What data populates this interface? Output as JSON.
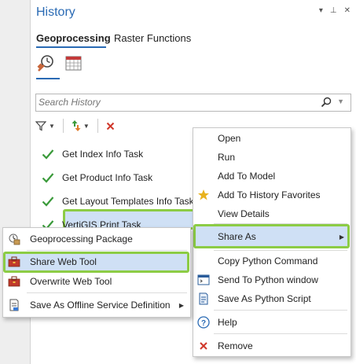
{
  "pane": {
    "title": "History",
    "controls": [
      "▾",
      "⊥",
      "✕"
    ]
  },
  "tabs": [
    {
      "label": "Geoprocessing",
      "selected": true
    },
    {
      "label": "Raster Functions",
      "selected": false
    }
  ],
  "search": {
    "placeholder": "Search History"
  },
  "history_items": [
    {
      "label": "Get Index Info Task"
    },
    {
      "label": "Get Product Info Task"
    },
    {
      "label": "Get Layout Templates Info Task"
    },
    {
      "label": "VertiGIS Print Task",
      "selected": true
    }
  ],
  "context_menu": {
    "items": [
      {
        "label": "Open",
        "icon": ""
      },
      {
        "label": "Run",
        "icon": ""
      },
      {
        "label": "Add To Model",
        "icon": ""
      },
      {
        "label": "Add To History Favorites",
        "icon": "star-icon"
      },
      {
        "label": "View Details",
        "icon": ""
      },
      {
        "label": "Share As",
        "icon": "",
        "submenu": true,
        "highlighted": true
      },
      {
        "label": "Copy Python Command",
        "icon": ""
      },
      {
        "label": "Send To Python window",
        "icon": "python-window-icon"
      },
      {
        "label": "Save As Python Script",
        "icon": "python-script-icon"
      },
      {
        "label": "Help",
        "icon": "help-icon"
      },
      {
        "label": "Remove",
        "icon": "remove-icon"
      }
    ]
  },
  "share_submenu": {
    "items": [
      {
        "label": "Geoprocessing Package",
        "icon": "package-icon"
      },
      {
        "label": "Share Web Tool",
        "icon": "web-tool-icon",
        "highlighted": true
      },
      {
        "label": "Overwrite Web Tool",
        "icon": "overwrite-web-tool-icon"
      },
      {
        "label": "Save As Offline Service Definition",
        "icon": "service-definition-icon",
        "submenu": true
      }
    ]
  },
  "colors": {
    "accent": "#2a6ab4",
    "highlight_fill": "#cfe0f5",
    "highlight_border": "#8ccc45",
    "check": "#3a9a3a",
    "remove": "#d0372a",
    "star": "#e8b21e"
  }
}
